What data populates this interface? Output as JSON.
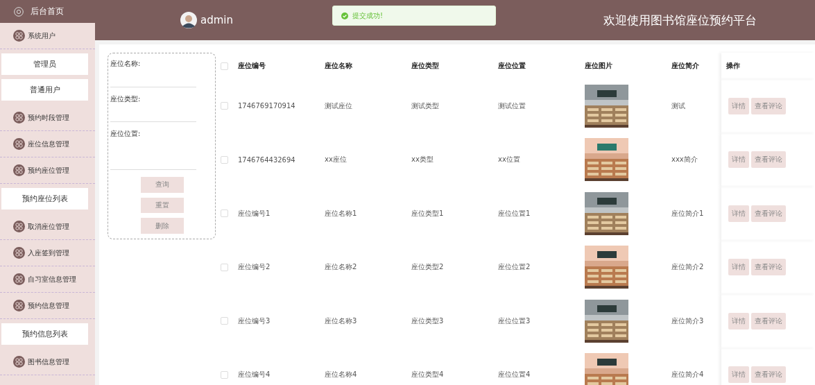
{
  "sidebar": {
    "home": "后台首页",
    "items": [
      {
        "kind": "menu",
        "label": "系统用户"
      },
      {
        "kind": "sub",
        "label": "管理员"
      },
      {
        "kind": "sub",
        "label": "普通用户"
      },
      {
        "kind": "menu",
        "label": "预约时段管理"
      },
      {
        "kind": "menu",
        "label": "座位信息管理"
      },
      {
        "kind": "menu",
        "label": "预约座位管理"
      },
      {
        "kind": "sub",
        "label": "预约座位列表"
      },
      {
        "kind": "menu",
        "label": "取消座位管理"
      },
      {
        "kind": "menu",
        "label": "入座签到管理"
      },
      {
        "kind": "menu",
        "label": "自习室信息管理"
      },
      {
        "kind": "menu",
        "label": "预约信息管理"
      },
      {
        "kind": "sub",
        "label": "预约信息列表"
      },
      {
        "kind": "menu",
        "label": "图书信息管理"
      }
    ]
  },
  "header": {
    "user": "admin",
    "toast": "提交成功!",
    "title": "欢迎使用图书馆座位预约平台"
  },
  "search": {
    "fields": [
      "座位名称:",
      "座位类型:",
      "座位位置:"
    ],
    "buttons": [
      "查询",
      "重置",
      "删除"
    ]
  },
  "table": {
    "all_checked": false,
    "columns": [
      "座位编号",
      "座位名称",
      "座位类型",
      "座位位置",
      "座位图片",
      "座位简介",
      "操作"
    ],
    "rows": [
      {
        "checked": false,
        "cells": [
          "1746769170914",
          "测试座位",
          "测试类型",
          "测试位置"
        ],
        "picture": {
          "kind": "picture"
        },
        "intro": "测试",
        "actions": [
          "详情",
          "查看评论"
        ]
      },
      {
        "checked": false,
        "cells": [
          "1746764432694",
          "xx座位",
          "xx类型",
          "xx位置"
        ],
        "picture": {
          "kind": "picture"
        },
        "intro": "xxx简介",
        "actions": [
          "详情",
          "查看评论"
        ]
      },
      {
        "checked": false,
        "cells": [
          "座位编号1",
          "座位名称1",
          "座位类型1",
          "座位位置1"
        ],
        "picture": {
          "kind": "picture"
        },
        "intro": "座位简介1",
        "actions": [
          "详情",
          "查看评论"
        ]
      },
      {
        "checked": false,
        "cells": [
          "座位编号2",
          "座位名称2",
          "座位类型2",
          "座位位置2"
        ],
        "picture": {
          "kind": "picture"
        },
        "intro": "座位简介2",
        "actions": [
          "详情",
          "查看评论"
        ]
      },
      {
        "checked": false,
        "cells": [
          "座位编号3",
          "座位名称3",
          "座位类型3",
          "座位位置3"
        ],
        "picture": {
          "kind": "picture"
        },
        "intro": "座位简介3",
        "actions": [
          "详情",
          "查看评论"
        ]
      },
      {
        "checked": false,
        "cells": [
          "座位编号4",
          "座位名称4",
          "座位类型4",
          "座位位置4"
        ],
        "picture": {
          "kind": "picture"
        },
        "intro": "座位简介4",
        "actions": [
          "详情",
          "查看评论"
        ]
      }
    ]
  }
}
